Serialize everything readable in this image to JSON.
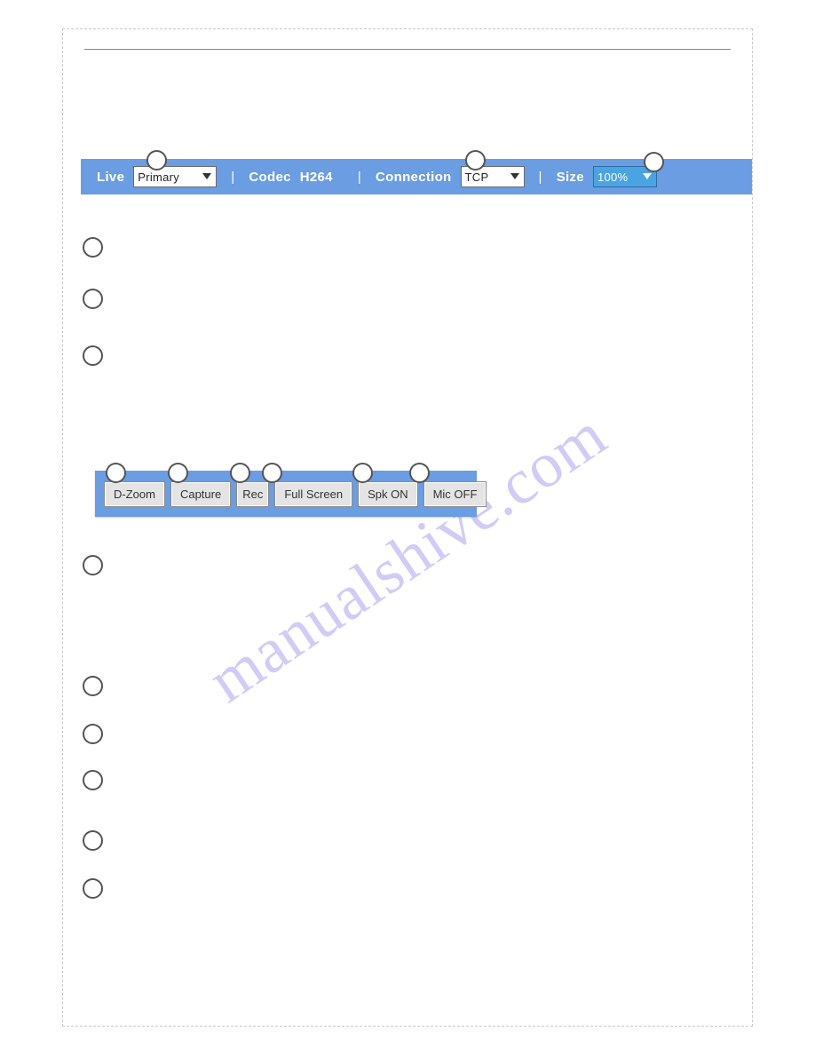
{
  "topbar": {
    "live_label": "Live",
    "live_select": "Primary",
    "codec_label": "Codec",
    "codec_value": "H264",
    "conn_label": "Connection",
    "conn_select": "TCP",
    "size_label": "Size",
    "size_select": "100%"
  },
  "buttons": {
    "dzoom": "D-Zoom",
    "capture": "Capture",
    "rec": "Rec",
    "fullscreen": "Full Screen",
    "spk": "Spk ON",
    "mic": "Mic OFF"
  },
  "watermark": "manualshive.com"
}
